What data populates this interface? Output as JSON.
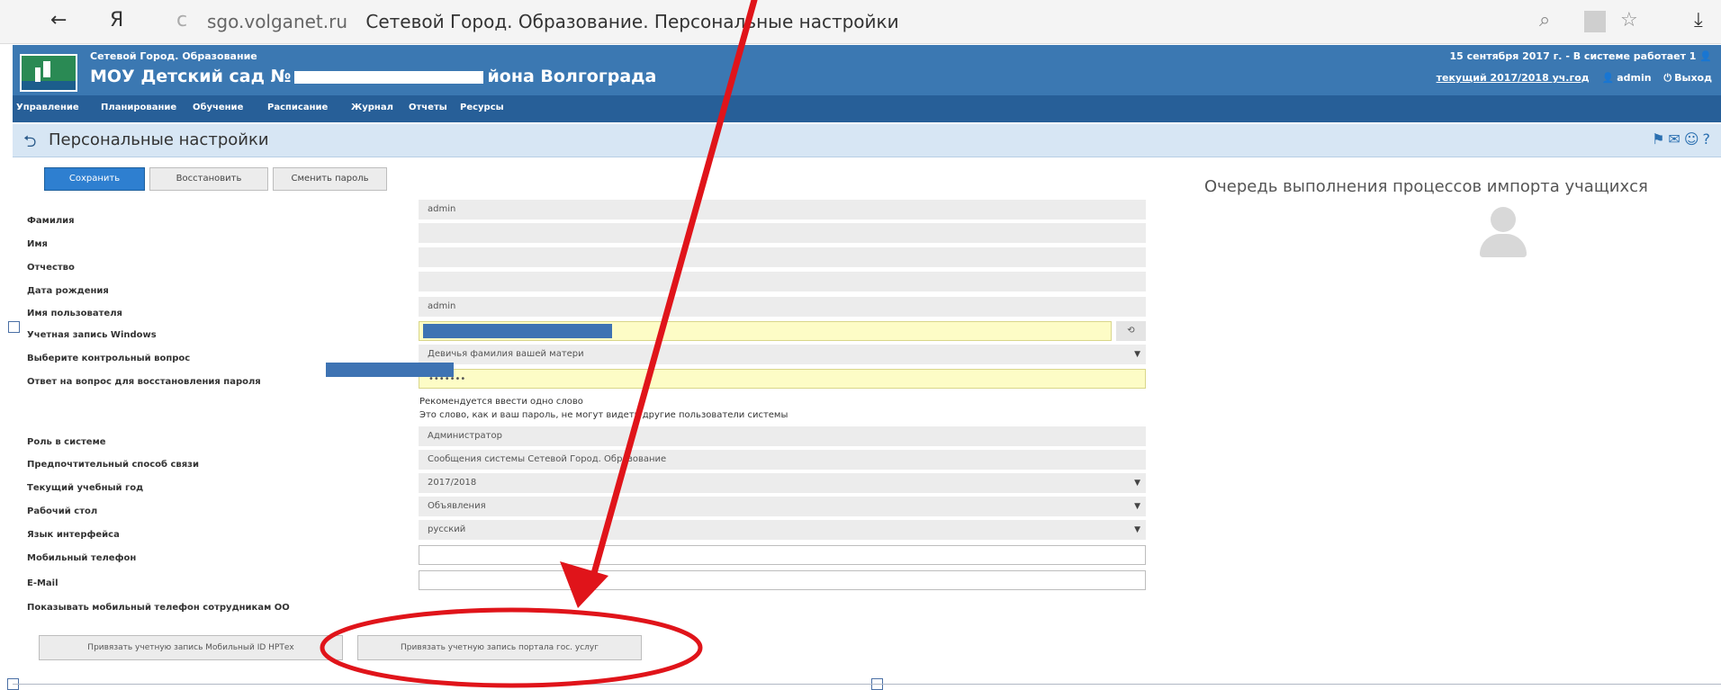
{
  "browser": {
    "back_icon": "←",
    "yandex_icon": "Я",
    "reload_icon": "c",
    "domain": "sgo.volganet.ru",
    "page_title": "Сетевой Город. Образование. Персональные настройки",
    "search_icon": "⌕",
    "bookmark_icon": "☆",
    "download_icon": "⤓"
  },
  "header": {
    "system_name": "Сетевой Город. Образование",
    "school_name_start": "МОУ Детский сад №",
    "school_name_end": "йона Волгограда",
    "date_info": "15 сентября 2017 г. - В системе работает 1",
    "year_info": "текущий 2017/2018 уч.год",
    "user": "admin",
    "logout": "Выход"
  },
  "menu": [
    "Управление",
    "Планирование",
    "Обучение",
    "Расписание",
    "Журнал",
    "Отчеты",
    "Ресурсы"
  ],
  "page": {
    "title": "Персональные настройки",
    "icons": "⚑✉☺?"
  },
  "toolbar": {
    "save": "Сохранить",
    "restore": "Восстановить",
    "change_password": "Сменить пароль"
  },
  "form": {
    "surname_label": "Фамилия",
    "surname_value": "admin",
    "name_label": "Имя",
    "patronymic_label": "Отчество",
    "birthdate_label": "Дата рождения",
    "username_label": "Имя пользователя",
    "username_value": "admin",
    "windows_label": "Учетная запись Windows",
    "question_label": "Выберите контрольный вопрос",
    "question_value": "Девичья фамилия вашей матери",
    "answer_label": "Ответ на вопрос для восстановления пароля",
    "answer_value": "•••••••",
    "hint1": "Рекомендуется ввести одно слово",
    "hint2": "Это слово, как и ваш пароль, не могут видеть другие пользователи системы",
    "role_label": "Роль в системе",
    "role_value": "Администратор",
    "contact_label": "Предпочтительный способ связи",
    "contact_value": "Сообщения системы Сетевой Город. Образование",
    "year_label": "Текущий учебный год",
    "year_value": "2017/2018",
    "desktop_label": "Рабочий стол",
    "desktop_value": "Объявления",
    "language_label": "Язык интерфейса",
    "language_value": "русский",
    "mobile_label": "Мобильный телефон",
    "email_label": "E-Mail",
    "show_mobile_label": "Показывать мобильный телефон сотрудникам ОО"
  },
  "bottom_buttons": {
    "mobile_id": "Привязать учетную запись Мобильный ID НРТех",
    "gosuslugi": "Привязать учетную запись портала гос. услуг"
  },
  "side": {
    "title": "Очередь выполнения процессов импорта учащихся"
  },
  "colors": {
    "header_blue": "#3b78b2",
    "menu_blue": "#275f98",
    "annotation_red": "#e0141a",
    "highlight_yellow": "#fdfcc6"
  }
}
